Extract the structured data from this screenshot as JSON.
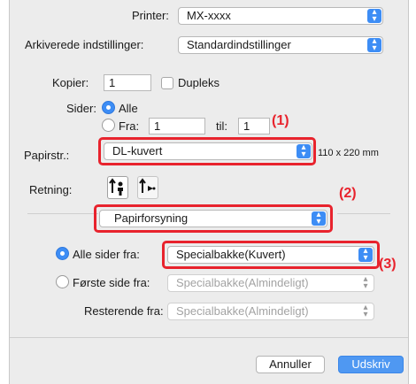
{
  "printer": {
    "label": "Printer:",
    "value": "MX-xxxx"
  },
  "presets": {
    "label": "Arkiverede indstillinger:",
    "value": "Standardindstillinger"
  },
  "copies": {
    "label": "Kopier:",
    "value": "1",
    "duplex_label": "Dupleks",
    "duplex_checked": false
  },
  "pages": {
    "label": "Sider:",
    "all_label": "Alle",
    "from_label": "Fra:",
    "from_value": "1",
    "to_label": "til:",
    "to_value": "1",
    "selected": "all"
  },
  "paper_size": {
    "label": "Papirstr.:",
    "value": "DL-kuvert",
    "dimensions": "110 x 220 mm"
  },
  "orientation": {
    "label": "Retning:",
    "selected": "portrait",
    "options": [
      "portrait-icon",
      "landscape-icon"
    ]
  },
  "section_menu": {
    "value": "Papirforsyning"
  },
  "paper_feed": {
    "all_pages": {
      "label": "Alle sider fra:",
      "value": "Specialbakke(Kuvert)",
      "selected": true
    },
    "first_page": {
      "label": "Første side fra:",
      "value": "Specialbakke(Almindeligt)",
      "selected": false
    },
    "remaining": {
      "label": "Resterende fra:",
      "value": "Specialbakke(Almindeligt)"
    }
  },
  "buttons": {
    "cancel": "Annuller",
    "print": "Udskriv"
  },
  "callouts": {
    "c1": "(1)",
    "c2": "(2)",
    "c3": "(3)"
  },
  "colors": {
    "accent": "#3d8df5",
    "highlight": "#e8232d",
    "dialog_bg": "#ececec"
  }
}
